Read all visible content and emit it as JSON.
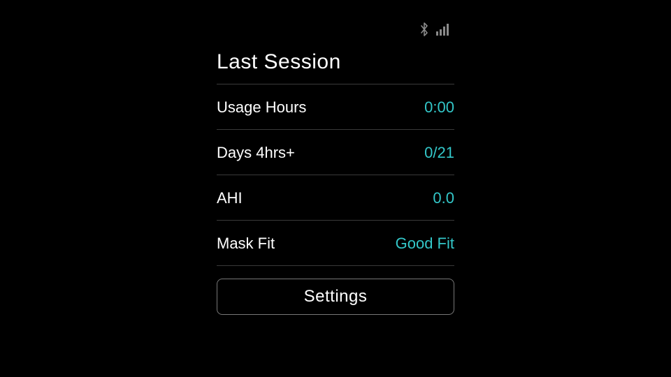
{
  "header": {
    "title": "Last Session",
    "bluetooth_icon": "bluetooth",
    "signal_icon": "signal-bars"
  },
  "metrics": {
    "usage_hours": {
      "label": "Usage Hours",
      "value": "0:00"
    },
    "days_4hrs": {
      "label": "Days 4hrs+",
      "value": "0/21"
    },
    "ahi": {
      "label": "AHI",
      "value": "0.0"
    },
    "mask_fit": {
      "label": "Mask Fit",
      "value": "Good Fit"
    }
  },
  "buttons": {
    "settings": "Settings"
  },
  "colors": {
    "accent": "#33c7c9",
    "divider": "#3a3a3a",
    "icon_muted": "#8a8a8a"
  }
}
